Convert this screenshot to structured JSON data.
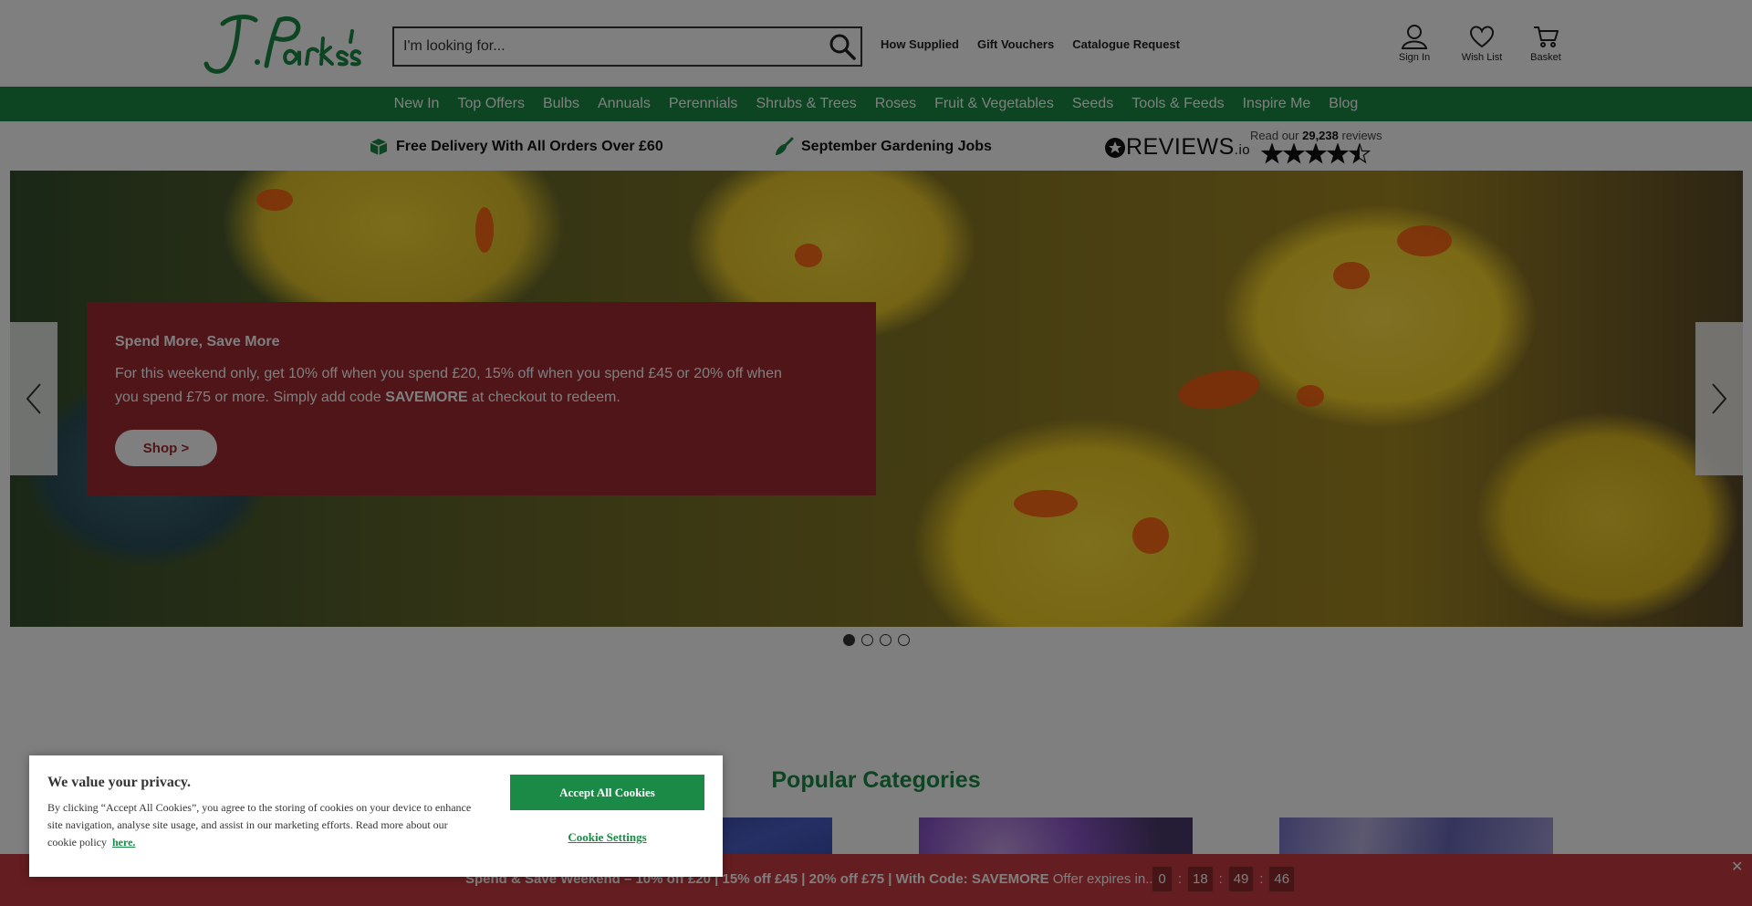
{
  "header": {
    "search_placeholder": "I'm looking for...",
    "top_links": [
      "How Supplied",
      "Gift Vouchers",
      "Catalogue Request"
    ],
    "sign_in": "Sign In",
    "wish_list": "Wish List",
    "basket": "Basket"
  },
  "nav": {
    "items": [
      "New In",
      "Top Offers",
      "Bulbs",
      "Annuals",
      "Perennials",
      "Shrubs & Trees",
      "Roses",
      "Fruit & Vegetables",
      "Seeds",
      "Tools & Feeds",
      "Inspire Me",
      "Blog"
    ]
  },
  "strip": {
    "delivery": "Free Delivery With All Orders Over £60",
    "jobs": "September Gardening Jobs",
    "reviews_brand": "REVIEWS",
    "reviews_suffix": ".io",
    "reviews_prefix": "Read our",
    "reviews_count": "29,238",
    "reviews_label": "reviews",
    "rating": 4.5
  },
  "hero": {
    "title": "Spend More, Save More",
    "body_1": "For this weekend only, get 10% off when you spend £20, 15% off when you spend £45 or 20% off when you spend £75 or more. Simply add code",
    "code": "SAVEMORE",
    "body_2": "at checkout to redeem.",
    "button": "Shop >",
    "slides": 4,
    "active_slide": 1
  },
  "popular": {
    "title": "Popular Categories"
  },
  "cookie": {
    "title": "We value your privacy.",
    "text": "By clicking “Accept All Cookies”, you agree to the storing of cookies on your device to enhance site navigation, analyse site usage, and assist in our marketing efforts. Read more about our cookie policy",
    "link": "here.",
    "accept": "Accept All Cookies",
    "settings": "Cookie Settings"
  },
  "bottom_bar": {
    "prefix": " Spend & Save Weekend  – 10% off £20 | 15% off £45 | 20% off £75 | With Code:",
    "code": "SAVEMORE",
    "expires": "Offer expires in...",
    "timer": [
      "0",
      "18",
      "49",
      "46"
    ],
    "close": "✕"
  },
  "colors": {
    "brand_green": "#1b8a46",
    "promo_red": "#9e2a30",
    "bar_red": "#c93a40"
  }
}
